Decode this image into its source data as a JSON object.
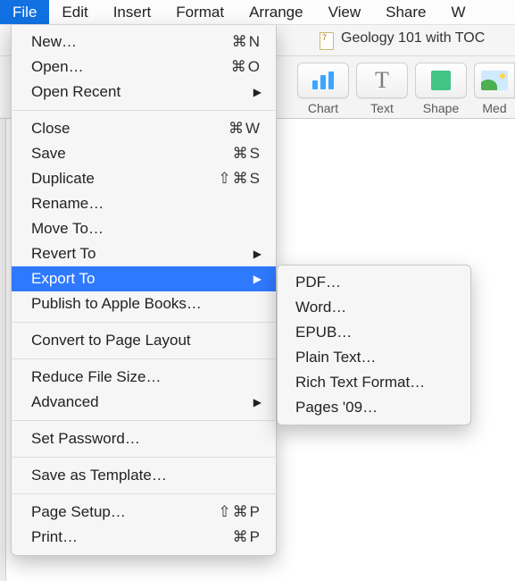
{
  "menubar": {
    "items": [
      {
        "label": "File",
        "selected": true
      },
      {
        "label": "Edit"
      },
      {
        "label": "Insert"
      },
      {
        "label": "Format"
      },
      {
        "label": "Arrange"
      },
      {
        "label": "View"
      },
      {
        "label": "Share"
      },
      {
        "label": "W"
      }
    ]
  },
  "tab": {
    "title": "Geology 101 with TOC"
  },
  "toolbar": {
    "chart": "Chart",
    "text": "Text",
    "shape": "Shape",
    "media": "Med"
  },
  "file_menu": [
    {
      "kind": "item",
      "label": "New…",
      "accel": "⌘N"
    },
    {
      "kind": "item",
      "label": "Open…",
      "accel": "⌘O"
    },
    {
      "kind": "item",
      "label": "Open Recent",
      "submenu": true
    },
    {
      "kind": "sep"
    },
    {
      "kind": "item",
      "label": "Close",
      "accel": "⌘W"
    },
    {
      "kind": "item",
      "label": "Save",
      "accel": "⌘S"
    },
    {
      "kind": "item",
      "label": "Duplicate",
      "accel": "⇧⌘S"
    },
    {
      "kind": "item",
      "label": "Rename…"
    },
    {
      "kind": "item",
      "label": "Move To…"
    },
    {
      "kind": "item",
      "label": "Revert To",
      "submenu": true
    },
    {
      "kind": "item",
      "label": "Export To",
      "submenu": true,
      "selected": true
    },
    {
      "kind": "item",
      "label": "Publish to Apple Books…"
    },
    {
      "kind": "sep"
    },
    {
      "kind": "item",
      "label": "Convert to Page Layout"
    },
    {
      "kind": "sep"
    },
    {
      "kind": "item",
      "label": "Reduce File Size…"
    },
    {
      "kind": "item",
      "label": "Advanced",
      "submenu": true
    },
    {
      "kind": "sep"
    },
    {
      "kind": "item",
      "label": "Set Password…"
    },
    {
      "kind": "sep"
    },
    {
      "kind": "item",
      "label": "Save as Template…"
    },
    {
      "kind": "sep"
    },
    {
      "kind": "item",
      "label": "Page Setup…",
      "accel": "⇧⌘P"
    },
    {
      "kind": "item",
      "label": "Print…",
      "accel": "⌘P"
    }
  ],
  "export_submenu": [
    {
      "label": "PDF…"
    },
    {
      "label": "Word…"
    },
    {
      "label": "EPUB…"
    },
    {
      "label": "Plain Text…"
    },
    {
      "label": "Rich Text Format…"
    },
    {
      "label": "Pages '09…"
    }
  ]
}
